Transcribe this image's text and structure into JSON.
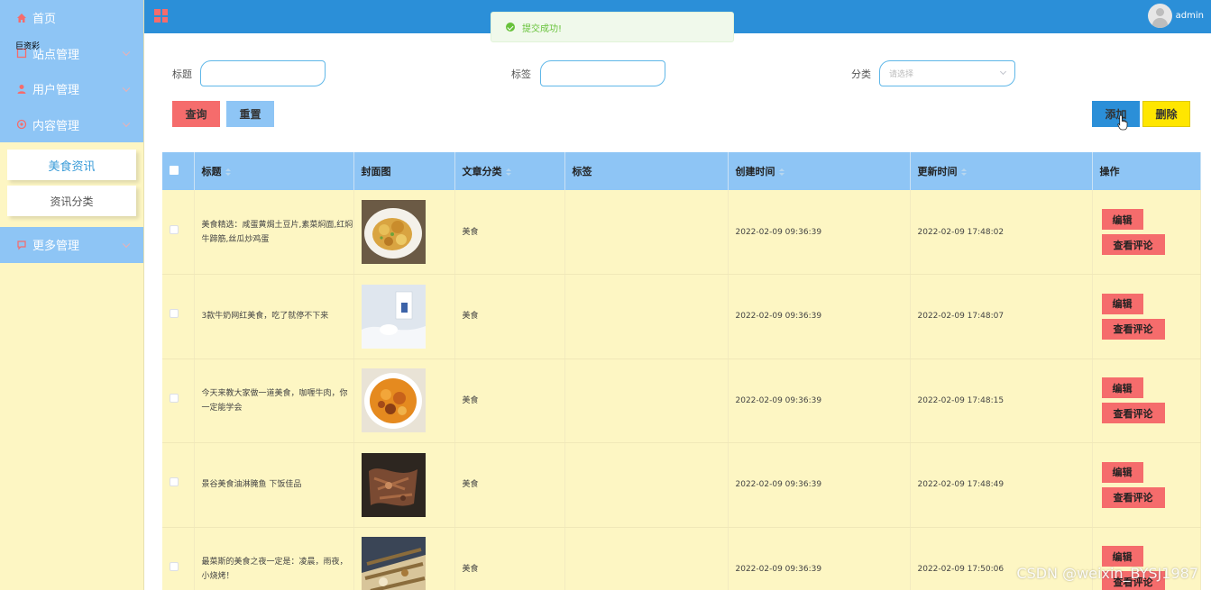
{
  "sidebar": {
    "overlay_label": "巨资彩",
    "top": [
      {
        "label": "首页",
        "icon": "home-icon"
      },
      {
        "label": "站点管理",
        "icon": "square-icon"
      },
      {
        "label": "用户管理",
        "icon": "user-icon"
      },
      {
        "label": "内容管理",
        "icon": "circle-icon"
      }
    ],
    "sub": [
      {
        "label": "美食资讯",
        "active": true
      },
      {
        "label": "资讯分类",
        "active": false
      }
    ],
    "bottom": [
      {
        "label": "更多管理",
        "icon": "chat-icon"
      }
    ]
  },
  "header": {
    "user": "admin"
  },
  "toast": {
    "message": "提交成功!"
  },
  "search": {
    "title_label": "标题",
    "tag_label": "标签",
    "category_label": "分类",
    "category_placeholder": "请选择",
    "query_button": "查询",
    "reset_button": "重置",
    "add_button": "添加",
    "delete_button": "删除"
  },
  "colors": {
    "header": "#2b8fd8",
    "sidebar_nav": "#8ec5f5",
    "sidebar_bg": "#fdf6c3",
    "query": "#f56c6c",
    "reset": "#8ec5f5",
    "add": "#2b8fd8",
    "delete": "#ffe600",
    "toast": "#67c23a"
  },
  "table": {
    "columns": [
      "标题",
      "封面图",
      "文章分类",
      "标签",
      "创建时间",
      "更新时间",
      "操作"
    ],
    "edit_label": "编辑",
    "review_label": "查看评论",
    "rows": [
      {
        "title": "美食精选：咸蛋黄焗土豆片,素菜焖面,红焖牛蹄筋,丝瓜炒鸡蛋",
        "category": "美食",
        "tag": "",
        "created": "2022-02-09 09:36:39",
        "updated": "2022-02-09 17:48:02"
      },
      {
        "title": "3款牛奶网红美食，吃了就停不下来",
        "category": "美食",
        "tag": "",
        "created": "2022-02-09 09:36:39",
        "updated": "2022-02-09 17:48:07"
      },
      {
        "title": "今天来教大家做一道美食，咖喱牛肉，你一定能学会",
        "category": "美食",
        "tag": "",
        "created": "2022-02-09 09:36:39",
        "updated": "2022-02-09 17:48:15"
      },
      {
        "title": "景谷美食油淋腌鱼 下饭佳品",
        "category": "美食",
        "tag": "",
        "created": "2022-02-09 09:36:39",
        "updated": "2022-02-09 17:48:49"
      },
      {
        "title": "最菜斯的美食之夜一定是：凌晨，雨夜，小烧烤！",
        "category": "美食",
        "tag": "",
        "created": "2022-02-09 09:36:39",
        "updated": "2022-02-09 17:50:06"
      }
    ]
  },
  "watermark": "CSDN @weixin_BYSJ1987"
}
